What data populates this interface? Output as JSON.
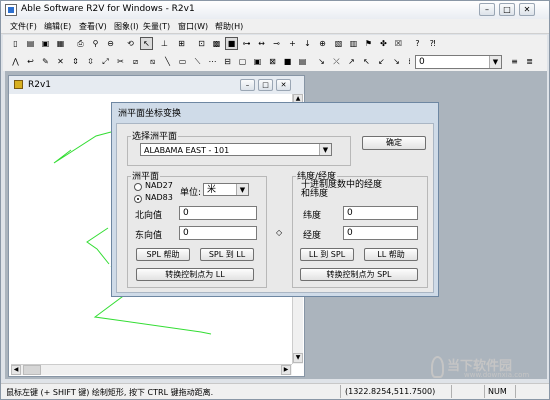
{
  "window": {
    "title": "Able Software R2V for Windows - R2v1",
    "min": "–",
    "max": "□",
    "close": "✕"
  },
  "menu": [
    "文件(F)",
    "编辑(E)",
    "查看(V)",
    "图象(I)",
    "矢量(T)",
    "窗口(W)",
    "帮助(H)"
  ],
  "toolbar1": {
    "combo_value": ""
  },
  "toolbar2": {
    "combo_value": "0"
  },
  "child": {
    "title": "R2v1"
  },
  "dialog": {
    "title": "洲平面坐标变换",
    "select_group": "选择洲平面",
    "select_value": "ALABAMA EAST - 101",
    "ok": "确定",
    "state_group": "洲平面",
    "nad27": "NAD27",
    "nad83": "NAD83",
    "unit_label": "单位:",
    "unit_value": "米",
    "north_label": "北向值",
    "north_value": "0",
    "east_label": "东向值",
    "east_value": "0",
    "spl_help": "SPL 帮助",
    "spl_to_ll": "SPL 到 LL",
    "convert_to_ll": "转换控制点为 LL",
    "ll_group": "纬度/经度",
    "ll_desc": "十进制度数中的经度和纬度",
    "lat_label": "纬度",
    "lat_value": "0",
    "lon_label": "经度",
    "lon_value": "0",
    "ll_to_spl": "LL 到 SPL",
    "ll_help": "LL 帮助",
    "convert_to_spl": "转换控制点为 SPL",
    "diamond": "◇"
  },
  "status": {
    "hint": "鼠标左键 (+ SHIFT 键) 绘制矩形, 按下 CTRL 键拖动距离.",
    "coords": "(1322.8254,511.7500)",
    "num": "NUM"
  },
  "watermark": {
    "text": "当下软件园",
    "sub": "www.downxia.com"
  },
  "colors": {
    "polyline": "#33dd33",
    "dialog_frame": "#cfdbe8"
  }
}
